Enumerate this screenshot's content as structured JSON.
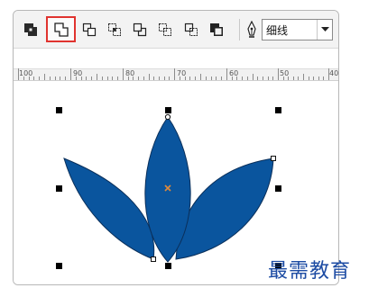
{
  "toolbar": {
    "tools": [
      {
        "icon": "combine-icon"
      },
      {
        "icon": "weld-icon",
        "selected": true
      },
      {
        "icon": "trim-icon"
      },
      {
        "icon": "intersect-icon"
      },
      {
        "icon": "simplify-icon"
      },
      {
        "icon": "front-minus-back-icon"
      },
      {
        "icon": "back-minus-front-icon"
      },
      {
        "icon": "create-boundary-icon"
      }
    ],
    "outline_width": {
      "icon": "pen-nib-icon",
      "value": "细线"
    }
  },
  "ruler": {
    "labels": [
      "100",
      "90",
      "80",
      "70",
      "60",
      "50",
      "40"
    ]
  },
  "canvas": {
    "shape_fill": "#0a559e",
    "shape_stroke": "#0a2f5a",
    "center_marker_color": "#e08a3a"
  },
  "watermark": {
    "text": "最需教育",
    "color": "#1c4ba3"
  },
  "colors": {
    "selected_outline": "#e0332f"
  }
}
